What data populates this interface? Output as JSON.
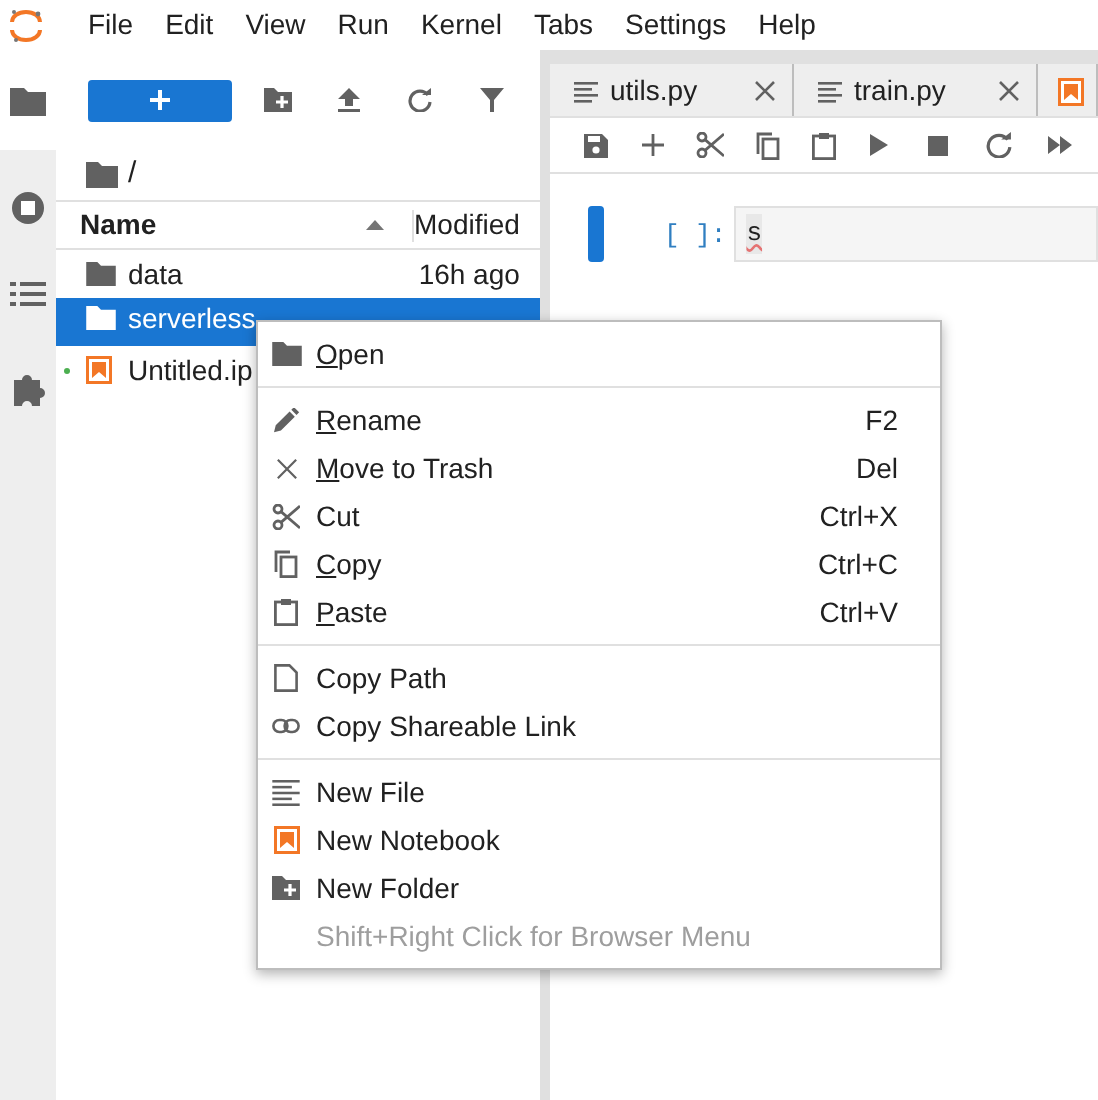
{
  "menu_bar": [
    "File",
    "Edit",
    "View",
    "Run",
    "Kernel",
    "Tabs",
    "Settings",
    "Help"
  ],
  "file_browser": {
    "path": "/",
    "columns": [
      "Name",
      "Modified"
    ],
    "rows": [
      {
        "name": "data",
        "modified": "16h ago",
        "kind": "folder",
        "selected": false,
        "running": false
      },
      {
        "name": "serverless",
        "kind": "folder",
        "selected": true,
        "running": false
      },
      {
        "name": "Untitled.ip",
        "kind": "notebook",
        "selected": false,
        "running": true
      }
    ]
  },
  "tabs": [
    {
      "label": "utils.py",
      "kind": "file"
    },
    {
      "label": "train.py",
      "kind": "file"
    },
    {
      "kind": "notebook"
    }
  ],
  "cell": {
    "prompt": "[ ]:",
    "input": "s"
  },
  "context_menu": {
    "sections": [
      [
        {
          "label": "Open",
          "kind": "folder",
          "underline_first": true,
          "disabled": false
        }
      ],
      [
        {
          "label": "Rename",
          "shortcut": "F2",
          "kind": "pencil",
          "underline_first": true,
          "disabled": false
        },
        {
          "label": "Move to Trash",
          "shortcut": "Del",
          "kind": "x",
          "underline_first": true,
          "disabled": false
        },
        {
          "label": "Cut",
          "shortcut": "Ctrl+X",
          "kind": "scissors",
          "underline_first": false,
          "disabled": false
        },
        {
          "label": "Copy",
          "shortcut": "Ctrl+C",
          "kind": "copy",
          "underline_first": true,
          "disabled": false
        },
        {
          "label": "Paste",
          "shortcut": "Ctrl+V",
          "kind": "paste",
          "underline_first": true,
          "disabled": false
        }
      ],
      [
        {
          "label": "Copy Path",
          "kind": "file",
          "underline_first": false,
          "disabled": false
        },
        {
          "label": "Copy Shareable Link",
          "kind": "link",
          "underline_first": false,
          "disabled": false
        }
      ],
      [
        {
          "label": "New File",
          "kind": "lines",
          "underline_first": false,
          "disabled": false
        },
        {
          "label": "New Notebook",
          "kind": "notebook",
          "underline_first": false,
          "disabled": false
        },
        {
          "label": "New Folder",
          "kind": "folder-plus",
          "underline_first": false,
          "disabled": false
        },
        {
          "label": "Shift+Right Click for Browser Menu",
          "kind": "hint",
          "underline_first": false,
          "disabled": true
        }
      ]
    ]
  }
}
